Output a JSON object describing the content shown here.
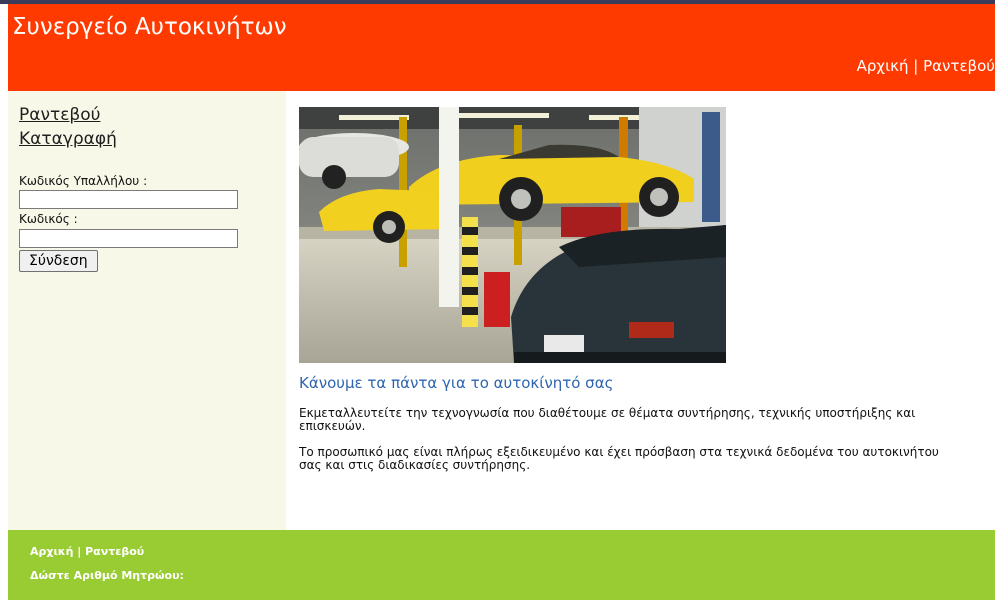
{
  "header": {
    "site_title": "Συνεργείο Αυτοκινήτων",
    "nav": {
      "home": "Αρχική",
      "separator": " | ",
      "appointments": "Ραντεβού"
    }
  },
  "sidebar": {
    "links": {
      "appointments": "Ραντεβού",
      "register": "Καταγραφή"
    },
    "login": {
      "employee_code_label": "Κωδικός Υπαλλήλου :",
      "employee_code_value": "",
      "password_label": "Κωδικός :",
      "password_value": "",
      "submit_label": "Σύνδεση"
    }
  },
  "main": {
    "image": {
      "alt": "garage-with-cars-on-lifts"
    },
    "headline": "Κάνουμε τα πάντα για το αυτοκίνητό σας",
    "paragraphs": [
      "Εκμεταλλευτείτε την τεχνογνωσία που διαθέτουμε σε θέματα συντήρησης, τεχνικής υποστήριξης και επισκευών.",
      "Το προσωπικό μας είναι πλήρως εξειδικευμένο και έχει πρόσβαση στα τεχνικά δεδομένα του αυτοκινήτου σας και στις διαδικασίες συντήρησης."
    ]
  },
  "footer": {
    "nav": {
      "home": "Αρχική",
      "separator": " | ",
      "appointments": "Ραντεβού"
    },
    "registration_label": "Δώστε Αριθμό Μητρώου:"
  },
  "colors": {
    "header_bg": "#ff3a00",
    "sidebar_bg": "#f8f8e8",
    "footer_bg": "#99cc33",
    "headline": "#2f65b0"
  }
}
